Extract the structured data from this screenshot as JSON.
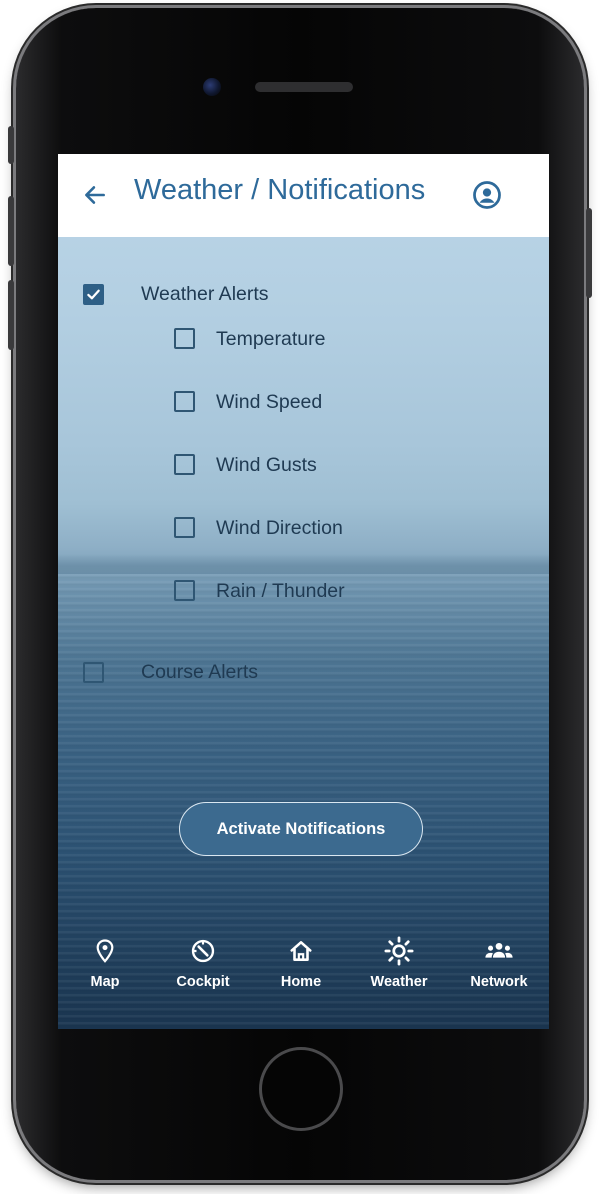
{
  "header": {
    "back_icon": "arrow-left-icon",
    "title": "Weather / Notifications",
    "profile_icon": "account-circle-icon",
    "title_color": "#2e6a9a"
  },
  "weather_alerts": {
    "label": "Weather Alerts",
    "checked": true,
    "options": [
      {
        "label": "Temperature",
        "checked": false
      },
      {
        "label": "Wind Speed",
        "checked": false
      },
      {
        "label": "Wind Gusts",
        "checked": false
      },
      {
        "label": "Wind Direction",
        "checked": false
      },
      {
        "label": "Rain / Thunder",
        "checked": false
      }
    ]
  },
  "course_alerts": {
    "label": "Course Alerts",
    "checked": false
  },
  "activate_button": {
    "label": "Activate Notifications"
  },
  "nav": {
    "items": [
      {
        "label": "Map",
        "icon": "map-pin-icon",
        "active": false
      },
      {
        "label": "Cockpit",
        "icon": "compass-icon",
        "active": false
      },
      {
        "label": "Home",
        "icon": "home-icon",
        "active": false
      },
      {
        "label": "Weather",
        "icon": "sun-icon",
        "active": true
      },
      {
        "label": "Network",
        "icon": "people-icon",
        "active": false
      }
    ]
  },
  "colors": {
    "accent": "#2e5f86",
    "button": "#3c6a8f",
    "checkbox_border": "#2f5673"
  }
}
